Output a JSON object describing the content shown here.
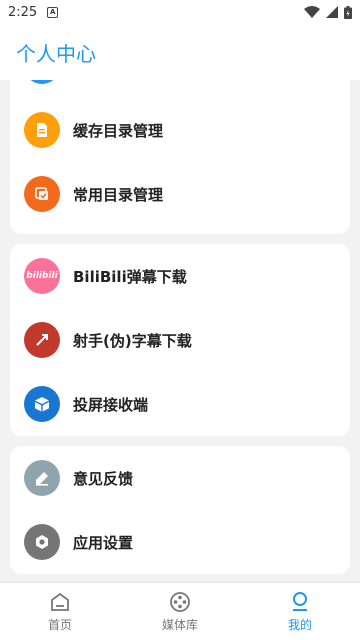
{
  "status_bar": {
    "time": "2:25",
    "notif_icon_letter": "A"
  },
  "header": {
    "title": "个人中心"
  },
  "cards": [
    {
      "items": [
        {
          "label": "",
          "icon": "folder-icon",
          "color": "#2196f3"
        },
        {
          "label": "缓存目录管理",
          "icon": "cache-folder-icon",
          "color": "#ff9f0a"
        },
        {
          "label": "常用目录管理",
          "icon": "common-folder-icon",
          "color": "#f26b1d"
        }
      ]
    },
    {
      "items": [
        {
          "label": "BiliBili弹幕下载",
          "icon": "bilibili-icon",
          "color": "#fb7299",
          "logo_text": "bilibili"
        },
        {
          "label": "射手(伪)字幕下载",
          "icon": "shooter-icon",
          "color": "#c0392b"
        },
        {
          "label": "投屏接收端",
          "icon": "cube-icon",
          "color": "#1976d2"
        }
      ]
    },
    {
      "items": [
        {
          "label": "意见反馈",
          "icon": "feedback-icon",
          "color": "#90a4ae"
        },
        {
          "label": "应用设置",
          "icon": "settings-icon",
          "color": "#757575"
        }
      ]
    }
  ],
  "bottom_nav": {
    "items": [
      {
        "label": "首页",
        "icon": "home-icon"
      },
      {
        "label": "媒体库",
        "icon": "film-reel-icon"
      },
      {
        "label": "我的",
        "icon": "profile-icon"
      }
    ],
    "active_color": "#2196f3"
  }
}
